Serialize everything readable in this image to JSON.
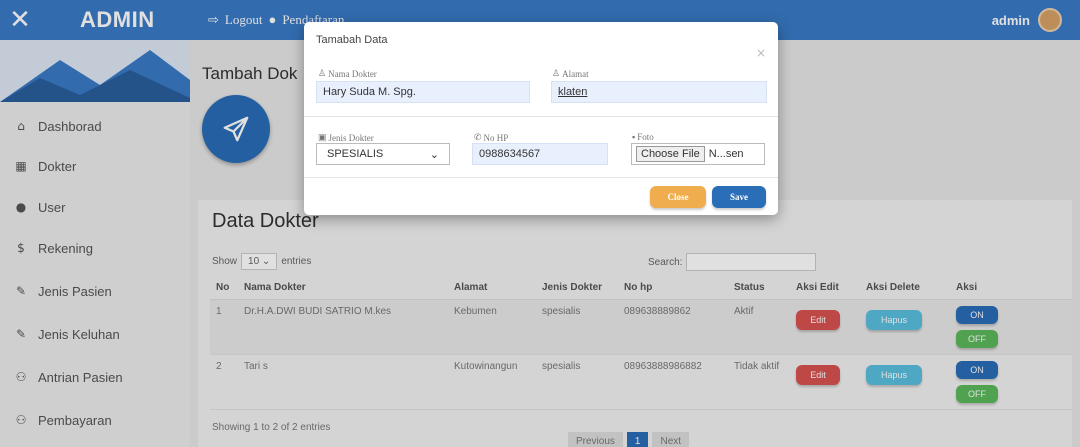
{
  "brand": {
    "title": "ADMIN",
    "close_icon": "close-icon"
  },
  "topnav": {
    "logout": "Logout",
    "pendaftaran": "Pendaftaran",
    "user": "admin"
  },
  "sidebar": {
    "items": [
      {
        "label": "Dashborad",
        "icon": "home-icon"
      },
      {
        "label": "Dokter",
        "icon": "building-icon"
      },
      {
        "label": "User",
        "icon": "user-icon"
      },
      {
        "label": "Rekening",
        "icon": "dollar-icon"
      },
      {
        "label": "Jenis Pasien",
        "icon": "edit-icon"
      },
      {
        "label": "Jenis Keluhan",
        "icon": "edit-icon"
      },
      {
        "label": "Antrian Pasien",
        "icon": "users-icon"
      },
      {
        "label": "Pembayaran",
        "icon": "users-icon"
      }
    ]
  },
  "page": {
    "heading": "Tambah Dok"
  },
  "panel": {
    "title": "Data Dokter",
    "show_label": "Show",
    "entries_value": "10",
    "entries_label": "entries",
    "search_label": "Search:",
    "columns": [
      "No",
      "Nama Dokter",
      "Alamat",
      "Jenis Dokter",
      "No hp",
      "Status",
      "Aksi Edit",
      "Aksi Delete",
      "Aksi"
    ],
    "rows": [
      {
        "no": "1",
        "nama": "Dr.H.A.DWI BUDI SATRIO M.kes",
        "alamat": "Kebumen",
        "jenis": "spesialis",
        "hp": "089638889862",
        "status": "Aktif",
        "edit": "Edit",
        "hapus": "Hapus",
        "on": "ON",
        "off": "OFF"
      },
      {
        "no": "2",
        "nama": "Tari s",
        "alamat": "Kutowinangun",
        "jenis": "spesialis",
        "hp": "08963888986882",
        "status": "Tidak aktif",
        "edit": "Edit",
        "hapus": "Hapus",
        "on": "ON",
        "off": "OFF"
      }
    ],
    "info": "Showing 1 to 2 of 2 entries",
    "pager": {
      "prev": "Previous",
      "current": "1",
      "next": "Next"
    }
  },
  "modal": {
    "title": "Tamabah Data",
    "close_icon": "×",
    "nama_label": "Nama Dokter",
    "nama_value": "Hary Suda M. Spg.",
    "alamat_label": "Alamat",
    "alamat_value": "klaten",
    "jenis_label": "Jenis Dokter",
    "jenis_value": "SPESIALIS",
    "hp_label": "No HP",
    "hp_value": "0988634567",
    "foto_label": "Foto",
    "file_button": "Choose File",
    "file_value": "N...sen",
    "close_button": "Close",
    "save_button": "Save"
  },
  "colors": {
    "primary": "#3a7bc8",
    "danger": "#d9534f",
    "info": "#5bc0de",
    "success": "#5cb85c",
    "warning": "#f0ad4e"
  }
}
